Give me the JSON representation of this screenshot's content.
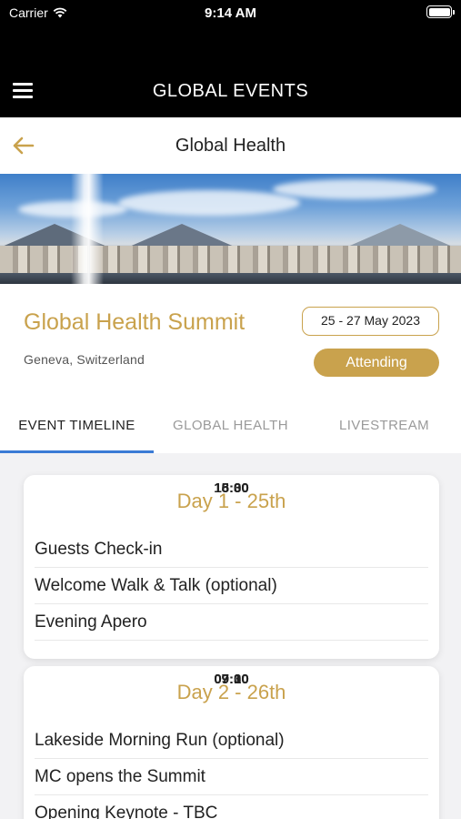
{
  "status_bar": {
    "carrier": "Carrier",
    "time": "9:14 AM"
  },
  "header": {
    "app_title": "GLOBAL EVENTS",
    "menu_icon": "hamburger-icon"
  },
  "nav": {
    "title": "Global Health",
    "back_icon": "arrow-left-icon"
  },
  "event": {
    "name": "Global Health Summit",
    "location": "Geneva, Switzerland",
    "dates": "25 - 27 May 2023",
    "status_button": "Attending"
  },
  "tabs": [
    {
      "label": "EVENT TIMELINE",
      "active": true
    },
    {
      "label": "GLOBAL HEALTH",
      "active": false
    },
    {
      "label": "LIVESTREAM",
      "active": false
    }
  ],
  "days": [
    {
      "title": "Day 1 - 25th",
      "items": [
        {
          "name": "Guests Check-in",
          "time": "15:00"
        },
        {
          "name": "Welcome Walk & Talk (optional)",
          "time": "16:30"
        },
        {
          "name": "Evening Apero",
          "time": "18:00"
        }
      ]
    },
    {
      "title": "Day 2 - 26th",
      "items": [
        {
          "name": "Lakeside Morning Run (optional)",
          "time": "07:30"
        },
        {
          "name": "MC opens the Summit",
          "time": "09:00"
        },
        {
          "name": "Opening Keynote - TBC",
          "time": "09:10"
        }
      ]
    }
  ],
  "colors": {
    "accent": "#c9a24d",
    "tab_indicator": "#3a7bd5",
    "header_bg": "#000000"
  }
}
